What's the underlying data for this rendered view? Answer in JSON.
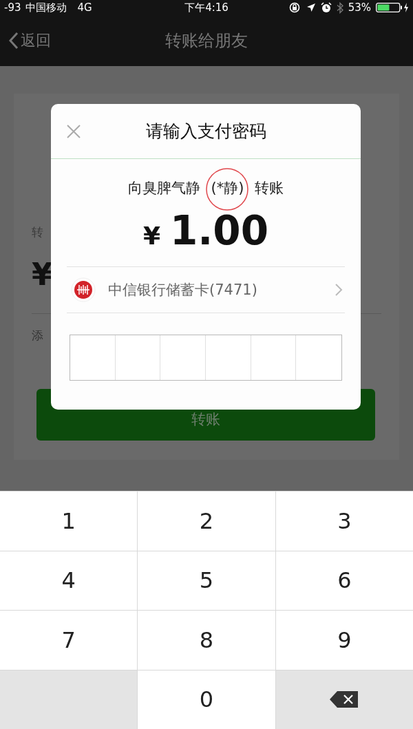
{
  "status_bar": {
    "signal": "-93",
    "carrier": "中国移动",
    "network": "4G",
    "time": "下午4:16",
    "battery": "53%"
  },
  "nav": {
    "back": "返回",
    "title": "转账给朋友"
  },
  "background": {
    "amount_label": "转",
    "currency": "¥",
    "note_link": "添",
    "button": "转账"
  },
  "dialog": {
    "title": "请输入支付密码",
    "payee": "向臭脾气静",
    "payee_account": "(*静)",
    "payee_highlighted": true,
    "action": "转账",
    "currency": "¥",
    "amount": "1.00",
    "card": "中信银行储蓄卡(7471)"
  },
  "keypad": {
    "keys": [
      {
        "kind": "digit",
        "label": "1"
      },
      {
        "kind": "digit",
        "label": "2"
      },
      {
        "kind": "digit",
        "label": "3"
      },
      {
        "kind": "digit",
        "label": "4"
      },
      {
        "kind": "digit",
        "label": "5"
      },
      {
        "kind": "digit",
        "label": "6"
      },
      {
        "kind": "digit",
        "label": "7"
      },
      {
        "kind": "digit",
        "label": "8"
      },
      {
        "kind": "digit",
        "label": "9"
      },
      {
        "kind": "blank"
      },
      {
        "kind": "digit",
        "label": "0"
      },
      {
        "kind": "backspace"
      }
    ]
  }
}
